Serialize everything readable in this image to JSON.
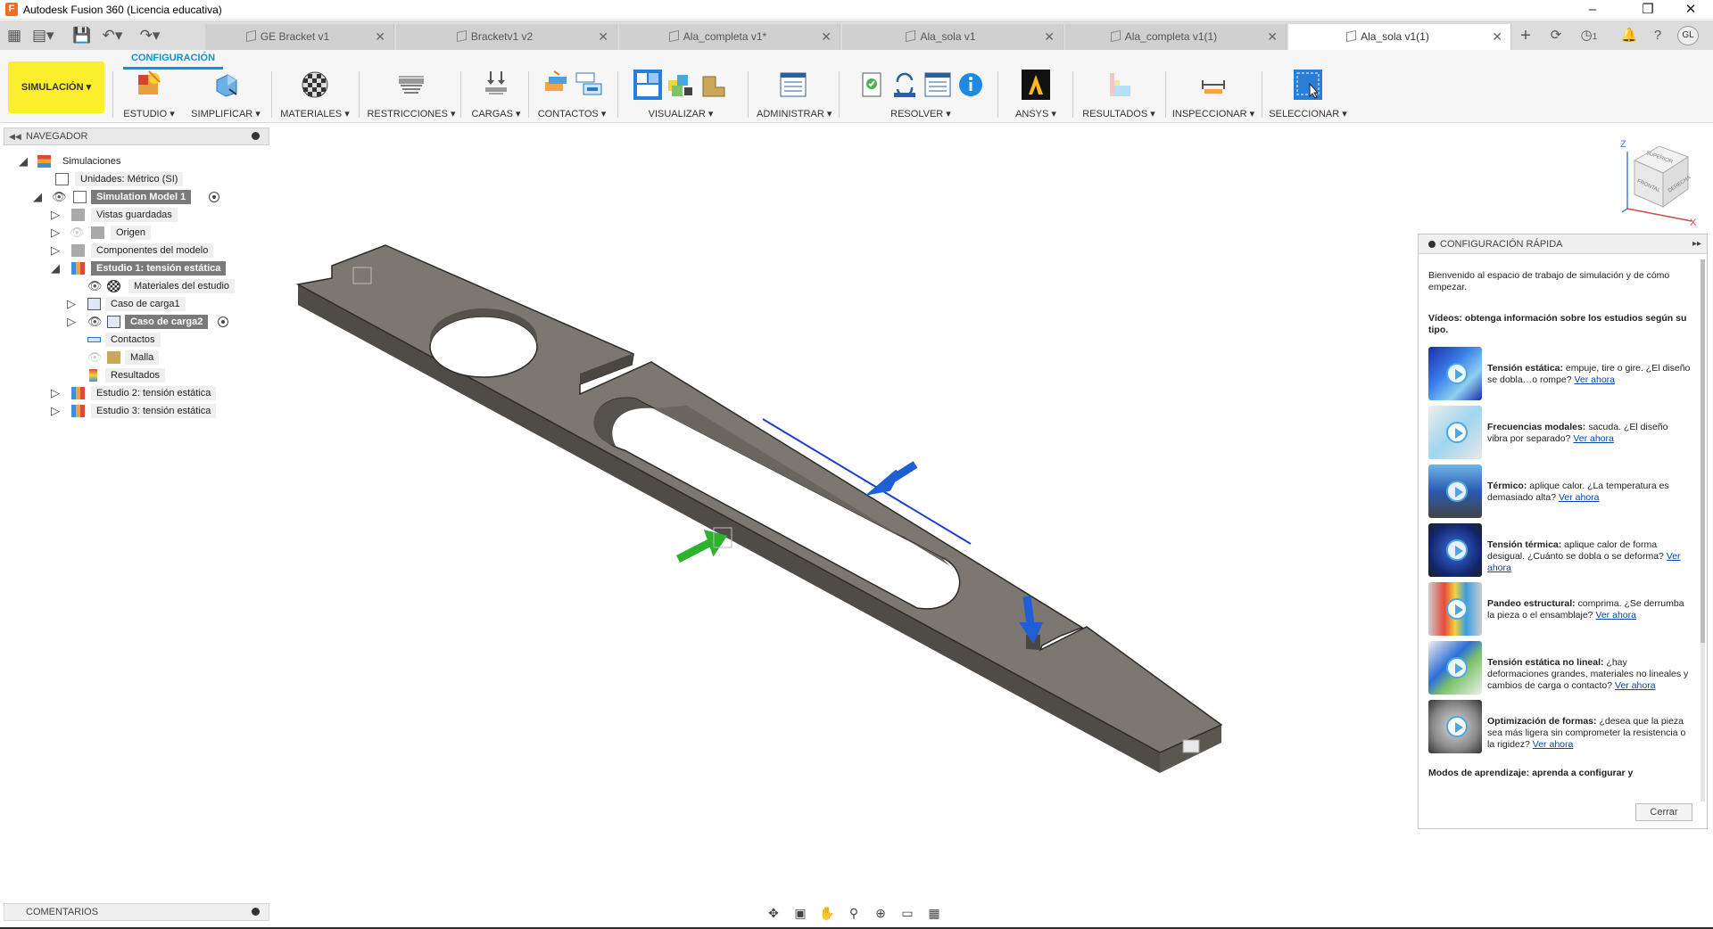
{
  "window": {
    "title": "Autodesk Fusion 360 (Licencia educativa)",
    "app_icon": "F",
    "minimize": "–",
    "maximize": "❐",
    "close": "✕"
  },
  "tabs": [
    {
      "label": "GE Bracket v1",
      "close": "✕"
    },
    {
      "label": "Bracketv1 v2",
      "close": "✕"
    },
    {
      "label": "Ala_completa v1*",
      "close": "✕"
    },
    {
      "label": "Ala_sola v1",
      "close": "✕"
    },
    {
      "label": "Ala_completa v1(1)",
      "close": "✕"
    },
    {
      "label": "Ala_sola v1(1)",
      "close": "✕"
    }
  ],
  "tabbar_right": {
    "add": "+",
    "notif_count": "1",
    "avatar": "GL"
  },
  "toolbar": {
    "workspace": "SIMULACIÓN ▾",
    "active_tab": "CONFIGURACIÓN",
    "groups": [
      "ESTUDIO ▾",
      "SIMPLIFICAR ▾",
      "MATERIALES ▾",
      "RESTRICCIONES ▾",
      "CARGAS ▾",
      "CONTACTOS ▾",
      "VISUALIZAR ▾",
      "ADMINISTRAR ▾",
      "RESOLVER ▾",
      "ANSYS ▾",
      "RESULTADOS ▾",
      "INSPECCIONAR ▾",
      "SELECCIONAR ▾"
    ]
  },
  "navigator": {
    "title": "NAVEGADOR",
    "items": [
      "Simulaciones",
      "Unidades: Métrico (SI)",
      "Simulation Model 1",
      "Vistas guardadas",
      "Origen",
      "Componentes del modelo",
      "Estudio 1: tensión estática",
      "Materiales del estudio",
      "Caso de carga1",
      "Caso de carga2",
      "Contactos",
      "Malla",
      "Resultados",
      "Estudio 2: tensión estática",
      "Estudio 3: tensión estática"
    ]
  },
  "viewcube": {
    "z": "Z",
    "x": "X",
    "top": "SUPERIOR",
    "front": "FRONTAL",
    "right": "DERECHA"
  },
  "quick_setup": {
    "title": "CONFIGURACIÓN RÁPIDA",
    "expand": "▸▸",
    "intro": "Bienvenido al espacio de trabajo de simulación y de cómo empezar.",
    "videos_title": "Vídeos: obtenga información sobre los estudios según su tipo.",
    "items": [
      {
        "title": "Tensión estática:",
        "desc": " empuje, tire o gire. ¿El diseño se dobla…o rompe?",
        "link": "Ver ahora"
      },
      {
        "title": "Frecuencias modales:",
        "desc": " sacuda. ¿El diseño vibra por separado?",
        "link": "Ver ahora"
      },
      {
        "title": "Térmico:",
        "desc": " aplique calor. ¿La temperatura es demasiado alta?",
        "link": "Ver ahora"
      },
      {
        "title": "Tensión térmica:",
        "desc": " aplique calor de forma desigual. ¿Cuánto se dobla o se deforma?",
        "link": "Ver ahora"
      },
      {
        "title": "Pandeo estructural:",
        "desc": " comprima. ¿Se derrumba la pieza o el ensamblaje?",
        "link": "Ver ahora"
      },
      {
        "title": "Tensión estática no lineal:",
        "desc": " ¿hay deformaciones grandes, materiales no lineales y cambios de carga o contacto?",
        "link": "Ver ahora"
      },
      {
        "title": "Optimización de formas:",
        "desc": " ¿desea que la pieza sea más ligera sin comprometer la resistencia o la rigidez?",
        "link": "Ver ahora"
      }
    ],
    "modes_title": "Modos de aprendizaje: aprenda a configurar y",
    "close_label": "Cerrar"
  },
  "comments": {
    "title": "COMENTARIOS"
  },
  "colors": {
    "accent": "#0696d7",
    "workspace_highlight": "#fbef2d",
    "part": "#7c7770",
    "load_blue": "#1f5fd6",
    "constraint_green": "#2db22d"
  }
}
